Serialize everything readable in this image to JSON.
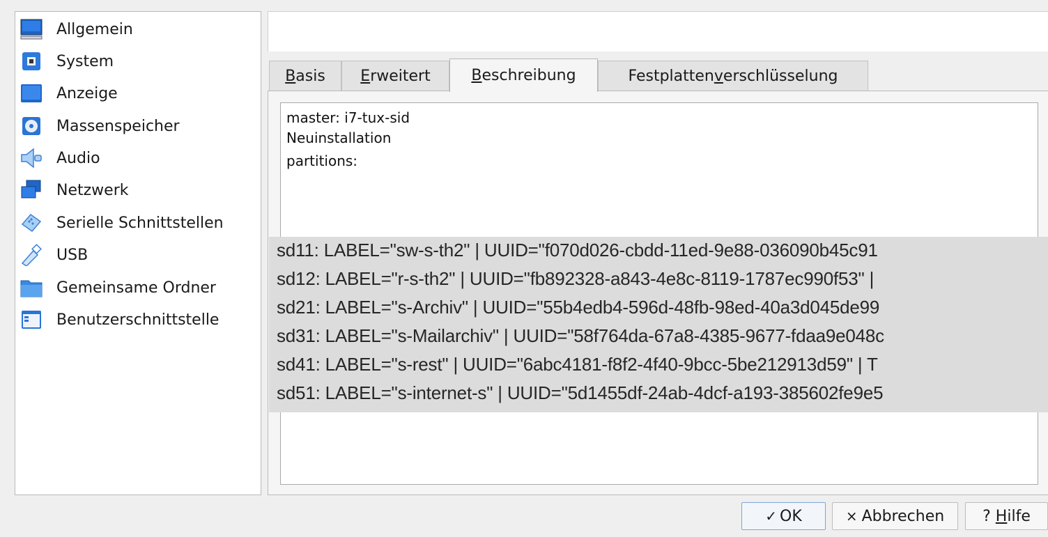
{
  "sidebar": {
    "items": [
      {
        "label": "Allgemein",
        "icon": "general-monitor-icon"
      },
      {
        "label": "System",
        "icon": "chip-icon"
      },
      {
        "label": "Anzeige",
        "icon": "display-icon"
      },
      {
        "label": "Massenspeicher",
        "icon": "disk-icon"
      },
      {
        "label": "Audio",
        "icon": "speaker-icon"
      },
      {
        "label": "Netzwerk",
        "icon": "network-icon"
      },
      {
        "label": "Serielle Schnittstellen",
        "icon": "serial-port-icon"
      },
      {
        "label": "USB",
        "icon": "usb-icon"
      },
      {
        "label": "Gemeinsame Ordner",
        "icon": "folder-icon"
      },
      {
        "label": "Benutzerschnittstelle",
        "icon": "user-interface-icon"
      }
    ]
  },
  "tabs": [
    {
      "prefix": "",
      "mnemonic": "B",
      "suffix": "asis"
    },
    {
      "prefix": "",
      "mnemonic": "E",
      "suffix": "rweitert"
    },
    {
      "prefix": "",
      "mnemonic": "B",
      "suffix": "eschreibung"
    },
    {
      "prefix": "Festplatten",
      "mnemonic": "v",
      "suffix": "erschlüsselung"
    }
  ],
  "description": {
    "lines": [
      "master: i7-tux-sid",
      "Neuinstallation",
      "partitions:"
    ]
  },
  "popup": {
    "lines": [
      "sd11: LABEL=\"sw-s-th2\" | UUID=\"f070d026-cbdd-11ed-9e88-036090b45c91",
      "sd12: LABEL=\"r-s-th2\" | UUID=\"fb892328-a843-4e8c-8119-1787ec990f53\" |",
      "sd21: LABEL=\"s-Archiv\" | UUID=\"55b4edb4-596d-48fb-98ed-40a3d045de99",
      "sd31: LABEL=\"s-Mailarchiv\" | UUID=\"58f764da-67a8-4385-9677-fdaa9e048c",
      "sd41: LABEL=\"s-rest\" | UUID=\"6abc4181-f8f2-4f40-9bcc-5be212913d59\" | T",
      "sd51: LABEL=\"s-internet-s\" | UUID=\"5d1455df-24ab-4dcf-a193-385602fe9e5"
    ]
  },
  "buttons": {
    "ok_symbol": "✓",
    "ok_label": "OK",
    "cancel_symbol": "×",
    "cancel_label": "Abbrechen",
    "help_prefix": "? ",
    "help_mnemonic": "H",
    "help_suffix": "ilfe"
  },
  "colors": {
    "accent": "#2a6fc9",
    "popup_bg": "#dcdcdc"
  }
}
